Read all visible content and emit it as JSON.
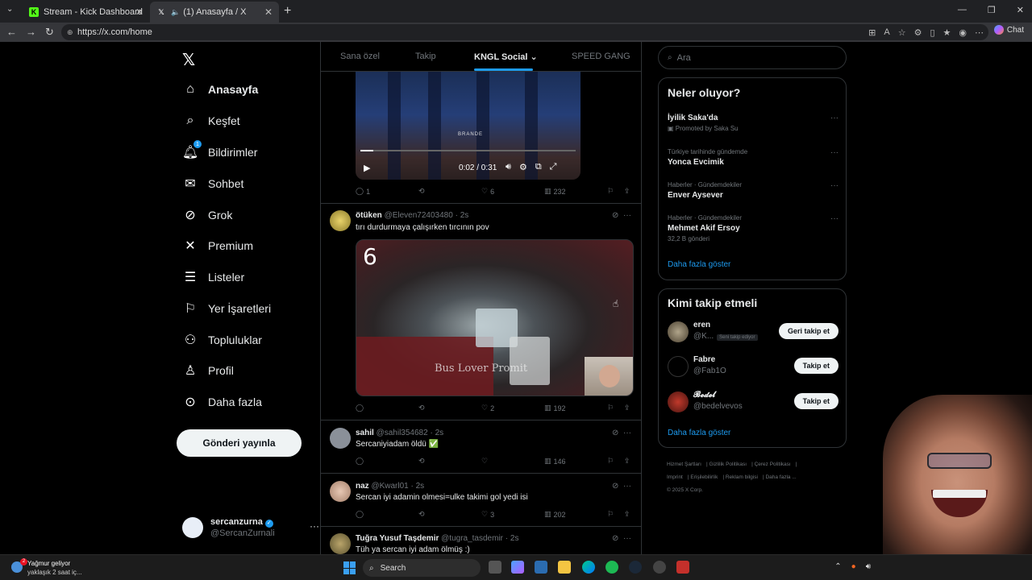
{
  "browser": {
    "tabs": [
      {
        "title": "Stream - Kick Dashboard",
        "icon": "kick-icon"
      },
      {
        "title": "(1) Anasayfa / X",
        "icon": "x-icon"
      }
    ],
    "url": "https://x.com/home",
    "chat_label": "Chat"
  },
  "sidebar": {
    "items": [
      {
        "label": "Anasayfa",
        "icon": "home-icon"
      },
      {
        "label": "Keşfet",
        "icon": "search-icon"
      },
      {
        "label": "Bildirimler",
        "icon": "bell-icon",
        "badge": "1"
      },
      {
        "label": "Sohbet",
        "icon": "mail-icon"
      },
      {
        "label": "Grok",
        "icon": "grok-icon"
      },
      {
        "label": "Premium",
        "icon": "x-icon"
      },
      {
        "label": "Listeler",
        "icon": "list-icon"
      },
      {
        "label": "Yer İşaretleri",
        "icon": "bookmark-icon"
      },
      {
        "label": "Topluluklar",
        "icon": "people-icon"
      },
      {
        "label": "Profil",
        "icon": "user-icon"
      },
      {
        "label": "Daha fazla",
        "icon": "more-circle-icon"
      }
    ],
    "post_button": "Gönderi yayınla",
    "profile": {
      "name": "sercanzurna",
      "handle": "@SercanZurnali"
    }
  },
  "feed": {
    "tabs": [
      "Sana özel",
      "Takip",
      "KNGL Social",
      "SPEED GANG"
    ],
    "active_tab": "KNGL Social",
    "video1": {
      "time": "0:02 / 0:31",
      "overlay": "BRANDE",
      "progress": 0.06
    },
    "tweet0_stats": {
      "replies": "1",
      "likes": "6",
      "views": "232"
    },
    "tweets": [
      {
        "name": "ötüken",
        "handle": "@Eleven72403480",
        "time": "2s",
        "text": "tırı durdurmaya çalışırken tırcının pov",
        "media_number": "6",
        "media_watermark": "Bus Lover Promit",
        "replies": "",
        "retweets": "",
        "likes": "2",
        "views": "192"
      },
      {
        "name": "sahil",
        "handle": "@sahil354682",
        "time": "2s",
        "text": "Sercaniyiadam öldü ✅",
        "replies": "",
        "retweets": "",
        "likes": "",
        "views": "146"
      },
      {
        "name": "naz",
        "handle": "@Kwarl01",
        "time": "2s",
        "text": "Sercan iyi adamin olmesi=ulke takimi gol yedi isi",
        "replies": "",
        "retweets": "",
        "likes": "3",
        "views": "202"
      },
      {
        "name": "Tuğra Yusuf Taşdemir",
        "handle": "@tugra_tasdemir",
        "time": "2s",
        "text": "Tüh ya sercan iyi adam ölmüş :)"
      }
    ]
  },
  "right": {
    "search_placeholder": "Ara",
    "trending": {
      "title": "Neler oluyor?",
      "items": [
        {
          "context": "",
          "title": "İyilik Saka'da",
          "sub": "Promoted by Saka Su"
        },
        {
          "context": "Türkiye tarihinde gündemde",
          "title": "Yonca Evcimik",
          "sub": ""
        },
        {
          "context": "Haberler · Gündemdekiler",
          "title": "Enver Aysever",
          "sub": ""
        },
        {
          "context": "Haberler · Gündemdekiler",
          "title": "Mehmet Akif Ersoy",
          "sub": "32,2 B gönderi"
        }
      ],
      "show_more": "Daha fazla göster"
    },
    "who_to_follow": {
      "title": "Kimi takip etmeli",
      "items": [
        {
          "name": "eren",
          "handle": "@K...",
          "badge": "Seni takip ediyor",
          "button": "Geri takip et"
        },
        {
          "name": "Fabre",
          "handle": "@Fab1O",
          "badge": "",
          "button": "Takip et"
        },
        {
          "name": "𝓑𝓮𝓭𝓮𝓵",
          "handle": "@bedelvevos",
          "badge": "",
          "button": "Takip et"
        }
      ],
      "show_more": "Daha fazla göster"
    },
    "footer": [
      "Hizmet Şartları",
      "Gizlilik Politikası",
      "Çerez Politikası",
      "Imprint",
      "Erişilebilirlik",
      "Reklam bilgisi",
      "Daha fazla ...",
      "© 2025 X Corp."
    ]
  },
  "taskbar": {
    "weather_title": "Yağmur geliyor",
    "weather_sub": "yaklaşık 2 saat iç...",
    "weather_badge": "2",
    "search_label": "Search"
  },
  "colors": {
    "accent": "#1d9bf0",
    "background": "#000000",
    "border": "#2f3336",
    "muted": "#71767b"
  }
}
